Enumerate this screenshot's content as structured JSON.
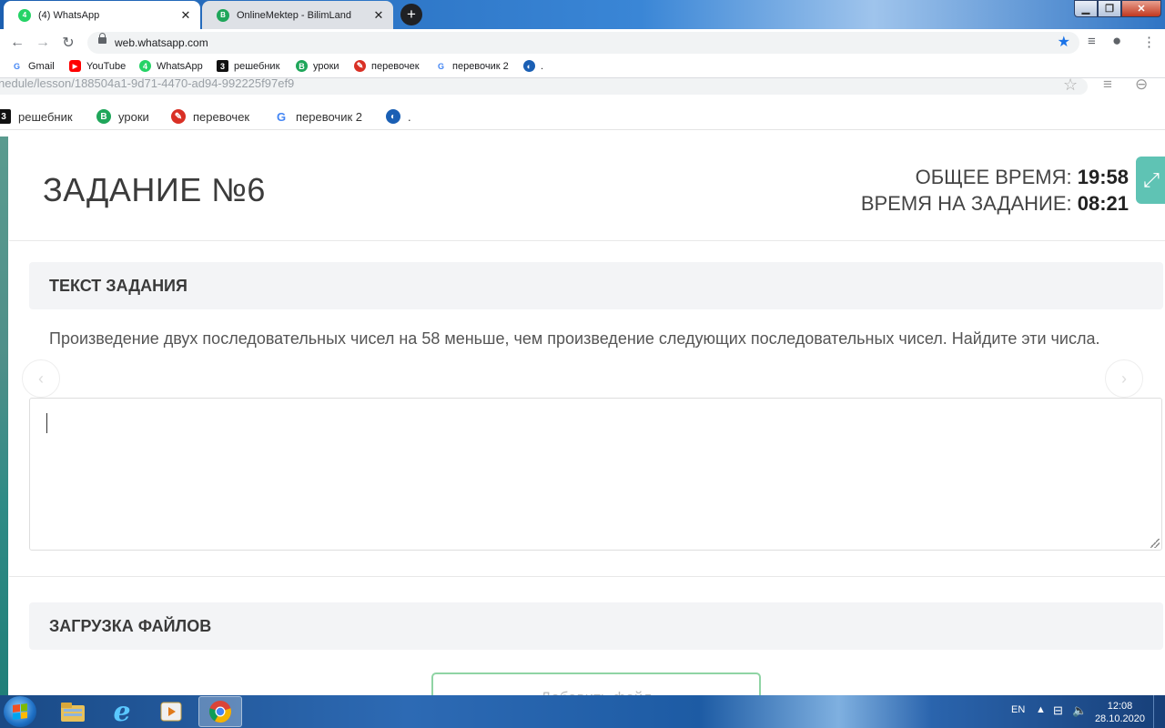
{
  "browser": {
    "tabs": [
      {
        "title": "(4) WhatsApp",
        "active": true,
        "favicon_icon": "whatsapp-icon",
        "favicon_text": "4"
      },
      {
        "title": "OnlineMektep - BilimLand",
        "active": false,
        "favicon_icon": "bilimland-icon",
        "favicon_text": "B"
      }
    ],
    "url": "web.whatsapp.com",
    "bookmarks": [
      {
        "label": "Gmail",
        "icon": "google-icon",
        "glyph": "G"
      },
      {
        "label": "YouTube",
        "icon": "youtube-icon",
        "glyph": "▶"
      },
      {
        "label": "WhatsApp",
        "icon": "whatsapp-icon",
        "glyph": "4"
      },
      {
        "label": "решебник",
        "icon": "reshebnik-icon",
        "glyph": "3"
      },
      {
        "label": "уроки",
        "icon": "bilimland-icon",
        "glyph": "B"
      },
      {
        "label": "перевочек",
        "icon": "translator-icon",
        "glyph": "✎"
      },
      {
        "label": "перевочик 2",
        "icon": "google-icon",
        "glyph": "G"
      },
      {
        "label": ".",
        "icon": "globe-icon",
        "glyph": "◐"
      }
    ]
  },
  "inner": {
    "url_fragment": "nedule/lesson/188504a1-9d71-4470-ad94-992225f97ef9",
    "bookmarks": [
      {
        "label": "решебник",
        "icon": "reshebnik-icon",
        "glyph": "3"
      },
      {
        "label": "уроки",
        "icon": "bilimland-icon",
        "glyph": "B"
      },
      {
        "label": "перевочек",
        "icon": "translator-icon",
        "glyph": "✎"
      },
      {
        "label": "перевочик 2",
        "icon": "google-icon",
        "glyph": "G"
      },
      {
        "label": ".",
        "icon": "globe-icon",
        "glyph": "◐"
      }
    ]
  },
  "task": {
    "title": "ЗАДАНИЕ №6",
    "total_time_label": "ОБЩЕЕ ВРЕМЯ: ",
    "total_time_value": "19:58",
    "task_time_label": "ВРЕМЯ НА ЗАДАНИЕ: ",
    "task_time_value": "08:21",
    "text_section_title": "ТЕКСТ ЗАДАНИЯ",
    "question": "Произведение двух последовательных чисел на 58 меньше, чем произведение следующих последовательных чисел. Найдите эти числа.",
    "answer_value": "",
    "upload_section_title": "ЗАГРУЗКА ФАЙЛОВ",
    "add_file_label": "Добавить файл"
  },
  "taskbar": {
    "apps": [
      "start-button",
      "explorer-icon",
      "internet-explorer-icon",
      "media-player-icon",
      "chrome-icon"
    ],
    "language": "EN",
    "time": "12:08",
    "date": "28.10.2020"
  },
  "colors": {
    "accent_teal": "#5fc3b4",
    "section_bg": "#f3f4f6",
    "whatsapp_green": "#25d366",
    "bilimland_green": "#1fa65a",
    "chrome_star": "#1a73e8"
  }
}
